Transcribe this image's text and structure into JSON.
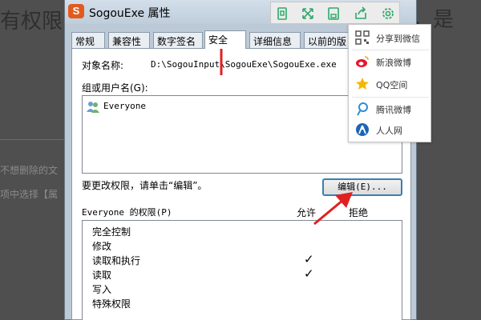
{
  "background": {
    "title": "有权限",
    "right_title": "，是",
    "lines": [
      "不想删除的文",
      "项中选择【属"
    ]
  },
  "dialog": {
    "app_icon_letter": "S",
    "title": "SogouExe 属性",
    "tabs": [
      "常规",
      "兼容性",
      "数字签名",
      "安全",
      "详细信息",
      "以前的版"
    ],
    "active_tab": "安全",
    "object_label": "对象名称:",
    "object_value": "D:\\SogouInput\\SogouExe\\SogouExe.exe",
    "group_label": "组或用户名(G):",
    "users": [
      "Everyone"
    ],
    "change_text": "要更改权限，请单击“编辑”。",
    "edit_button": "编辑(E)...",
    "perm_header": "Everyone 的权限(P)",
    "allow_label": "允许",
    "deny_label": "拒绝",
    "permissions": [
      {
        "name": "完全控制",
        "allow": false
      },
      {
        "name": "修改",
        "allow": false
      },
      {
        "name": "读取和执行",
        "allow": true
      },
      {
        "name": "读取",
        "allow": true
      },
      {
        "name": "写入",
        "allow": false
      },
      {
        "name": "特殊权限",
        "allow": false
      }
    ],
    "check_glyph": "✓"
  },
  "share": {
    "toolbar_icons": [
      "fit-screen-icon",
      "expand-icon",
      "save-icon",
      "share-icon",
      "settings-icon"
    ],
    "items": [
      {
        "label": "分享到微信",
        "icon": "qrcode-icon",
        "color": "#555555"
      },
      {
        "label": "新浪微博",
        "icon": "weibo-icon",
        "color": "#e6162d"
      },
      {
        "label": "QQ空间",
        "icon": "qzone-icon",
        "color": "#f5b800"
      },
      {
        "label": "腾讯微博",
        "icon": "tencent-weibo-icon",
        "color": "#2a8fd6"
      },
      {
        "label": "人人网",
        "icon": "renren-icon",
        "color": "#1c64b7"
      }
    ]
  },
  "colors": {
    "accent": "#2fa86b",
    "annotation": "#e02020"
  }
}
